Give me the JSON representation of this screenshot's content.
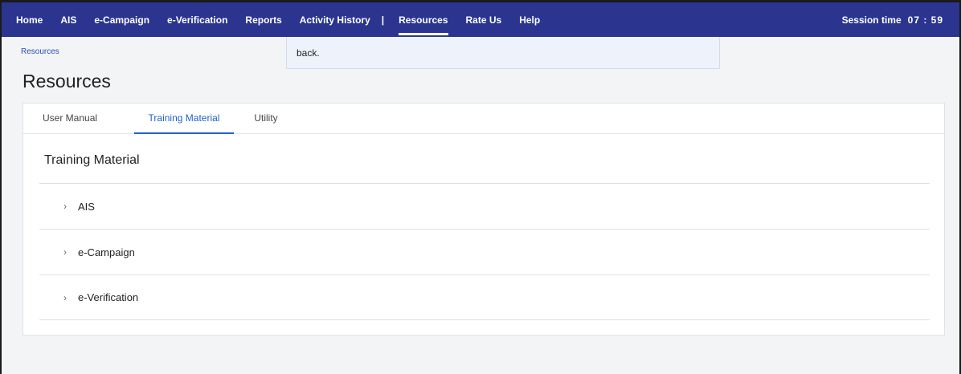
{
  "nav": {
    "items": [
      "Home",
      "AIS",
      "e-Campaign",
      "e-Verification",
      "Reports",
      "Activity History"
    ],
    "separator": "|",
    "items_right": [
      "Resources",
      "Rate Us",
      "Help"
    ],
    "active": "Resources",
    "session_label": "Session time",
    "session_value": "07 : 59"
  },
  "toast": {
    "text": "back."
  },
  "breadcrumb": "Resources",
  "page_title": "Resources",
  "tabs": [
    "User Manual",
    "Training Material",
    "Utility"
  ],
  "active_tab": "Training Material",
  "section_title": "Training Material",
  "accordion": [
    {
      "icon": "chevron-right-icon",
      "label": "AIS"
    },
    {
      "icon": "chevron-right-icon",
      "label": "e-Campaign"
    },
    {
      "icon": "chevron-right-icon",
      "label": "e-Verification"
    }
  ],
  "colors": {
    "nav_bg": "#2b3590",
    "accent": "#1f62c9"
  }
}
